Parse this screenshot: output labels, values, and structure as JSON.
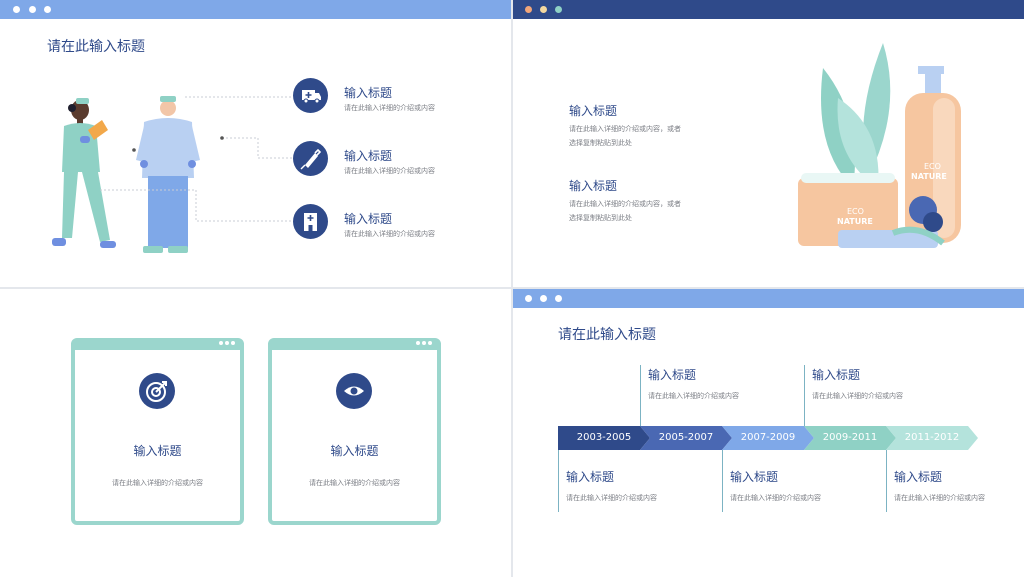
{
  "colors": {
    "navy": "#2f4a8a",
    "light_blue": "#7fa8e8",
    "mint": "#9bd6cd",
    "gray_text": "#7c7f86"
  },
  "slide1": {
    "title": "请在此输入标题",
    "items": [
      {
        "icon": "ambulance-icon",
        "heading": "输入标题",
        "desc": "请在此输入详细的介绍或内容"
      },
      {
        "icon": "syringe-icon",
        "heading": "输入标题",
        "desc": "请在此输入详细的介绍或内容"
      },
      {
        "icon": "hospital-icon",
        "heading": "输入标题",
        "desc": "请在此输入详细的介绍或内容"
      }
    ]
  },
  "slide2": {
    "blocks": [
      {
        "heading": "输入标题",
        "line1": "请在此输入详细的介绍或内容，或者",
        "line2": "选择复制粘贴到此处"
      },
      {
        "heading": "输入标题",
        "line1": "请在此输入详细的介绍或内容，或者",
        "line2": "选择复制粘贴到此处"
      }
    ],
    "label_eco": "ECO",
    "label_nature": "NATURE"
  },
  "slide3": {
    "cards": [
      {
        "icon": "target-icon",
        "heading": "输入标题",
        "desc": "请在此输入详细的介绍或内容"
      },
      {
        "icon": "eye-icon",
        "heading": "输入标题",
        "desc": "请在此输入详细的介绍或内容"
      }
    ]
  },
  "slide4": {
    "title": "请在此输入标题",
    "periods": [
      {
        "label": "2003-2005",
        "color": "#2f4a8a"
      },
      {
        "label": "2005-2007",
        "color": "#4a68b3"
      },
      {
        "label": "2007-2009",
        "color": "#7fa8e8"
      },
      {
        "label": "2009-2011",
        "color": "#8fd1c5"
      },
      {
        "label": "2011-2012",
        "color": "#b4e3dc"
      }
    ],
    "top_notes": [
      {
        "heading": "输入标题",
        "desc": "请在此输入详细的介绍或内容"
      },
      {
        "heading": "输入标题",
        "desc": "请在此输入详细的介绍或内容"
      }
    ],
    "bottom_notes": [
      {
        "heading": "输入标题",
        "desc": "请在此输入详细的介绍或内容"
      },
      {
        "heading": "输入标题",
        "desc": "请在此输入详细的介绍或内容"
      },
      {
        "heading": "输入标题",
        "desc": "请在此输入详细的介绍或内容"
      }
    ]
  }
}
